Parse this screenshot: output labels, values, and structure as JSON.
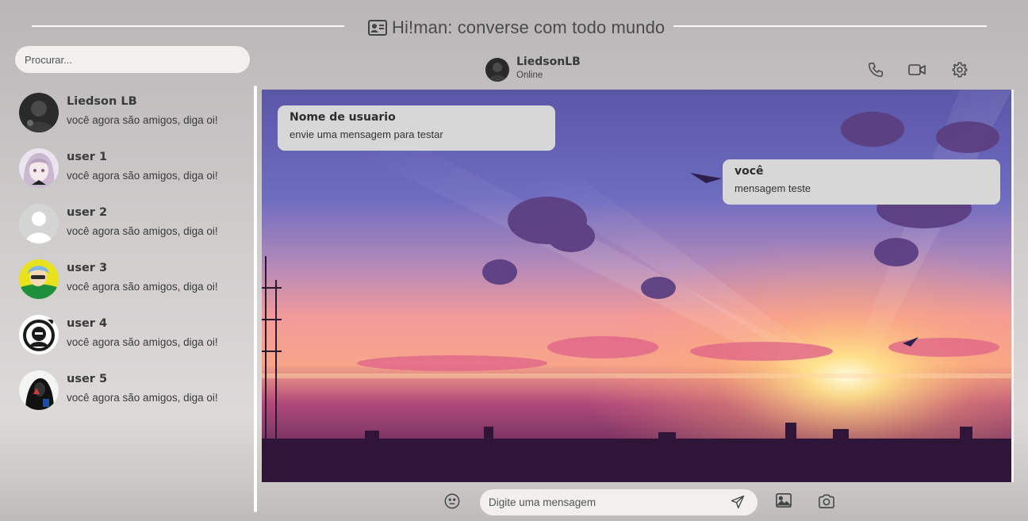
{
  "app": {
    "title": "Hi!man: converse com todo mundo"
  },
  "search": {
    "placeholder": "Procurar..."
  },
  "contacts": [
    {
      "name": "Liedson LB",
      "message": "você agora são amigos, diga oi!",
      "avatar": "dark-photo-avatar"
    },
    {
      "name": "user 1",
      "message": "você agora são amigos, diga oi!",
      "avatar": "anime-girl-avatar"
    },
    {
      "name": "user 2",
      "message": "você agora são amigos, diga oi!",
      "avatar": "default-person-avatar"
    },
    {
      "name": "user 3",
      "message": "você agora são amigos, diga oi!",
      "avatar": "yellow-anime-avatar"
    },
    {
      "name": "user 4",
      "message": "você agora são amigos, diga oi!",
      "avatar": "masked-figure-avatar"
    },
    {
      "name": "user 5",
      "message": "você agora são amigos, diga oi!",
      "avatar": "hooded-figure-avatar"
    }
  ],
  "chat": {
    "contact_name": "LiedsonLB",
    "status": "Online",
    "header_icons": [
      "phone-icon",
      "video-camera-icon",
      "gear-icon"
    ],
    "messages": [
      {
        "sender": "Nome de usuario",
        "text": "envie uma mensagem para testar",
        "side": "left"
      },
      {
        "sender": "você",
        "text": "mensagem teste",
        "side": "right"
      }
    ],
    "background": "sunset-city-wallpaper"
  },
  "composer": {
    "placeholder": "Digite uma mensagem",
    "icons": [
      "emoji-icon",
      "send-icon",
      "image-icon",
      "camera-icon"
    ]
  },
  "colors": {
    "bubble": "#d7d7d7",
    "input_bg": "#f1f0ef",
    "text": "#3a3a3a",
    "divider": "#ffffff"
  }
}
